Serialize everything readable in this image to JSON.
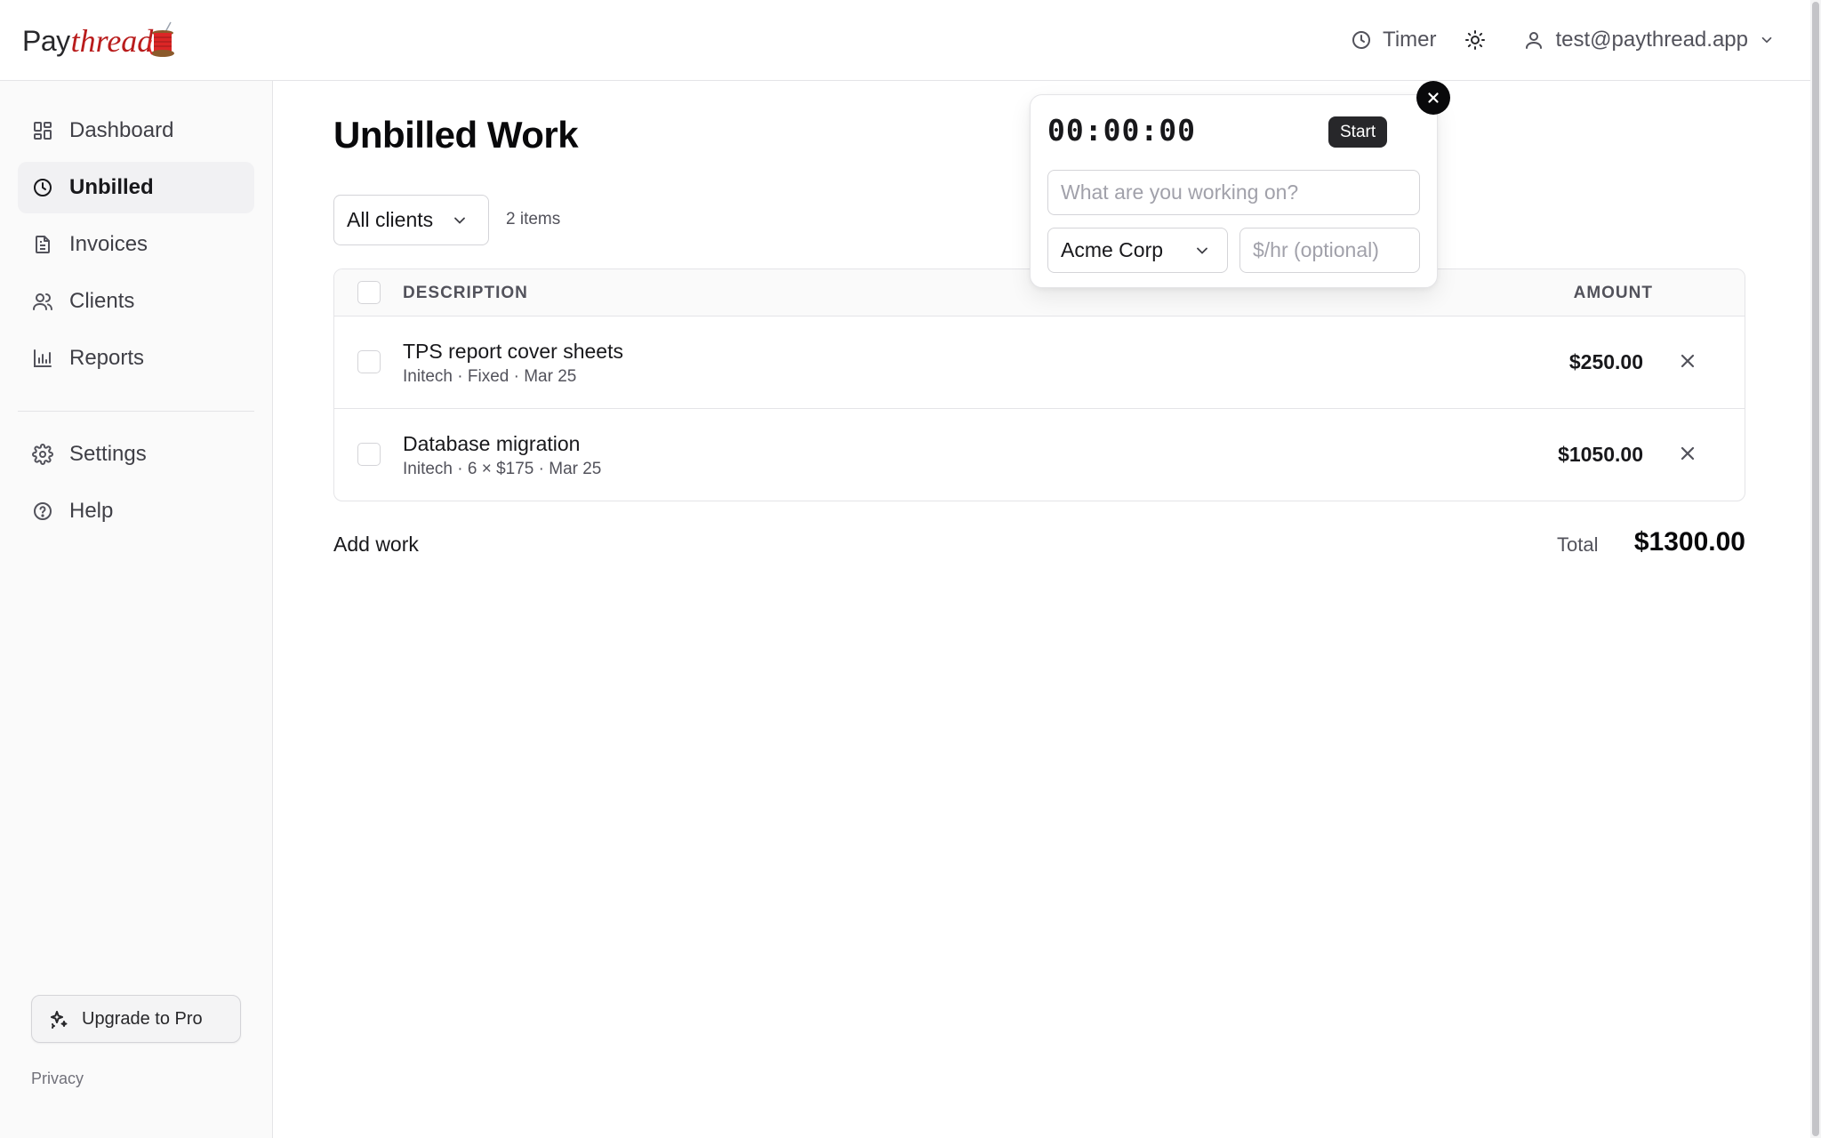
{
  "app": {
    "logo_pay": "Pay",
    "logo_thread": "thread"
  },
  "header": {
    "timer_label": "Timer",
    "timer_icon": "clock-icon",
    "theme_icon": "sun-icon",
    "user_email": "test@paythread.app"
  },
  "sidebar": {
    "items": [
      {
        "label": "Dashboard",
        "icon": "dashboard-icon"
      },
      {
        "label": "Unbilled",
        "icon": "clock-icon",
        "active": true
      },
      {
        "label": "Invoices",
        "icon": "file-icon"
      },
      {
        "label": "Clients",
        "icon": "users-icon"
      },
      {
        "label": "Reports",
        "icon": "bar-chart-icon"
      }
    ],
    "secondary": [
      {
        "label": "Settings",
        "icon": "gear-icon"
      },
      {
        "label": "Help",
        "icon": "help-circle-icon"
      }
    ],
    "upgrade_label": "Upgrade to Pro",
    "privacy_label": "Privacy"
  },
  "main": {
    "title": "Unbilled Work",
    "client_filter": "All clients",
    "items_count": "2 items",
    "table": {
      "columns": {
        "description": "DESCRIPTION",
        "amount": "AMOUNT"
      },
      "rows": [
        {
          "title": "TPS report cover sheets",
          "meta": "Initech · Fixed · Mar 25",
          "amount": "$250.00"
        },
        {
          "title": "Database migration",
          "meta": "Initech · 6 × $175 · Mar 25",
          "amount": "$1050.00"
        }
      ]
    },
    "add_work_label": "Add work",
    "total_label": "Total",
    "total_value": "$1300.00"
  },
  "timer_popover": {
    "display": "00:00:00",
    "start_label": "Start",
    "task_placeholder": "What are you working on?",
    "client_selected": "Acme Corp",
    "rate_placeholder": "$/hr (optional)"
  },
  "colors": {
    "accent": "#b91c1c",
    "primary_button": "#27272a",
    "text": "#18181b"
  }
}
